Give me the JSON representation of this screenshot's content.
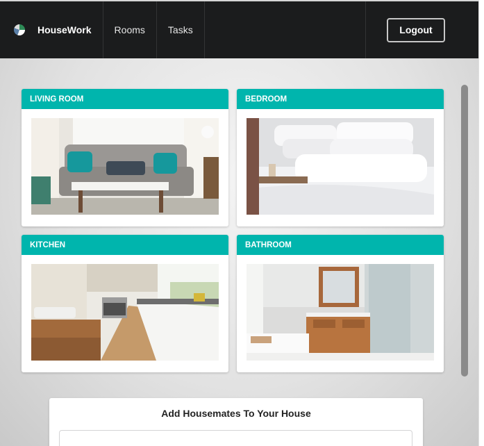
{
  "navbar": {
    "brand": "HouseWork",
    "items": [
      {
        "label": "Rooms"
      },
      {
        "label": "Tasks"
      }
    ],
    "logout_label": "Logout"
  },
  "rooms": [
    {
      "title": "LIVING ROOM"
    },
    {
      "title": "BEDROOM"
    },
    {
      "title": "KITCHEN"
    },
    {
      "title": "BATHROOM"
    }
  ],
  "housemates": {
    "title": "Add Housemates To Your House",
    "input_value": ""
  },
  "colors": {
    "navbar_bg": "#1b1c1d",
    "room_header_teal": "#00b5ad"
  }
}
